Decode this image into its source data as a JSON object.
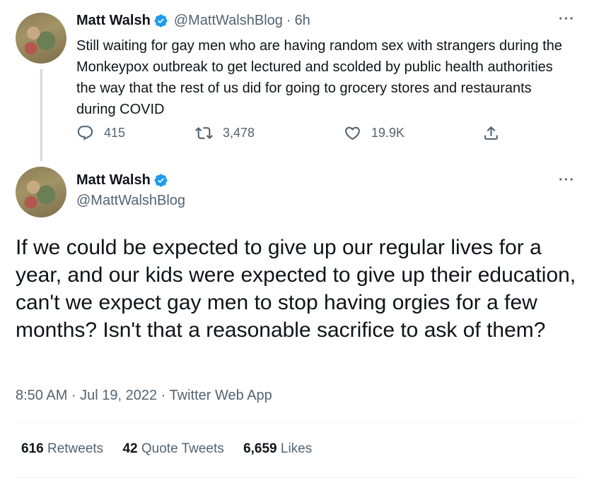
{
  "reply_tweet": {
    "author_name": "Matt Walsh",
    "handle": "@MattWalshBlog",
    "separator": "·",
    "time": "6h",
    "more": "···",
    "text": "Still waiting for gay men who are having random sex with strangers during the Monkeypox outbreak to get lectured and scolded by public health authorities the way that the rest of us did for going to grocery stores and restaurants during COVID",
    "actions": {
      "replies": "415",
      "retweets": "3,478",
      "likes": "19.9K"
    }
  },
  "main_tweet": {
    "author_name": "Matt Walsh",
    "handle": "@MattWalshBlog",
    "more": "···",
    "text": "If we could be expected to give up our regular lives for a year, and our kids were expected to give up their education, can't we expect gay men to stop having orgies for a few months? Isn't that a reasonable sacrifice to ask of them?",
    "meta": "8:50 AM · Jul 19, 2022 · Twitter Web App",
    "stats": {
      "retweets_count": "616",
      "retweets_label": "Retweets",
      "quotes_count": "42",
      "quotes_label": "Quote Tweets",
      "likes_count": "6,659",
      "likes_label": "Likes"
    }
  },
  "colors": {
    "verified": "#1d9bf0",
    "secondary_text": "#536471",
    "primary_text": "#0f1419"
  }
}
